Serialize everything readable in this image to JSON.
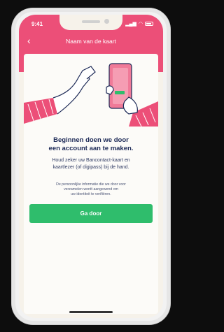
{
  "status_bar": {
    "time": "9:41",
    "signal": "▂▄▆",
    "wifi": "◠"
  },
  "header": {
    "back_glyph": "‹",
    "title": "Naam van de kaart"
  },
  "content": {
    "heading_line1": "Beginnen doen we door",
    "heading_line2": "een account aan te maken.",
    "body_line1": "Houd zeker uw Bancontact-kaart en",
    "body_line2": "kaartlezer (of digipass) bij de hand.",
    "fine_print_line1": "De persoonlijke informatie die we door voor",
    "fine_print_line2": "verzamelen wordt aangewend om",
    "fine_print_line3": "uw identiteit te verifiëren."
  },
  "button": {
    "label": "Ga door"
  },
  "colors": {
    "accent": "#ec4f78",
    "primary_button": "#2fbd6c",
    "heading_text": "#1d2a57",
    "background": "#f6f2ea"
  },
  "icons": [
    "back-arrow-icon",
    "signal-icon",
    "wifi-icon",
    "battery-icon"
  ]
}
